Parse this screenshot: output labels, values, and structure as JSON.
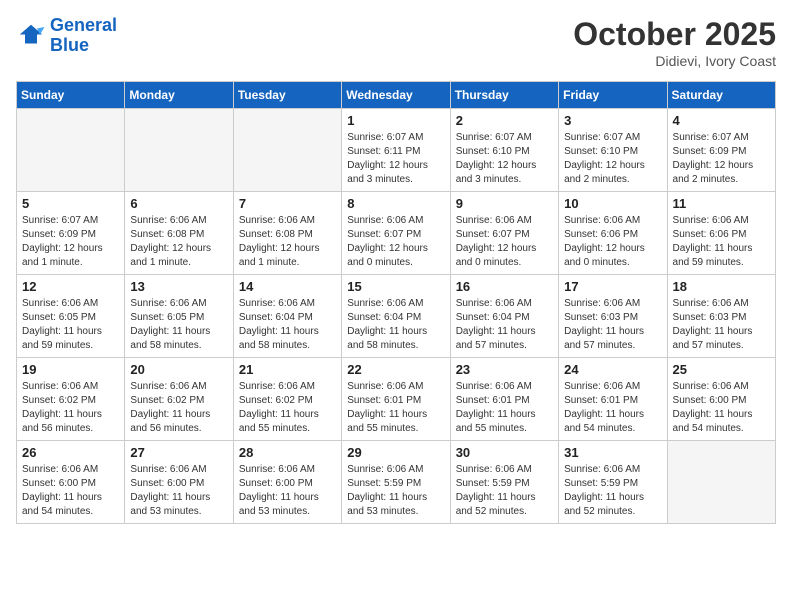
{
  "header": {
    "logo_line1": "General",
    "logo_line2": "Blue",
    "month_year": "October 2025",
    "location": "Didievi, Ivory Coast"
  },
  "days_of_week": [
    "Sunday",
    "Monday",
    "Tuesday",
    "Wednesday",
    "Thursday",
    "Friday",
    "Saturday"
  ],
  "weeks": [
    [
      {
        "day": "",
        "info": ""
      },
      {
        "day": "",
        "info": ""
      },
      {
        "day": "",
        "info": ""
      },
      {
        "day": "1",
        "info": "Sunrise: 6:07 AM\nSunset: 6:11 PM\nDaylight: 12 hours and 3 minutes."
      },
      {
        "day": "2",
        "info": "Sunrise: 6:07 AM\nSunset: 6:10 PM\nDaylight: 12 hours and 3 minutes."
      },
      {
        "day": "3",
        "info": "Sunrise: 6:07 AM\nSunset: 6:10 PM\nDaylight: 12 hours and 2 minutes."
      },
      {
        "day": "4",
        "info": "Sunrise: 6:07 AM\nSunset: 6:09 PM\nDaylight: 12 hours and 2 minutes."
      }
    ],
    [
      {
        "day": "5",
        "info": "Sunrise: 6:07 AM\nSunset: 6:09 PM\nDaylight: 12 hours and 1 minute."
      },
      {
        "day": "6",
        "info": "Sunrise: 6:06 AM\nSunset: 6:08 PM\nDaylight: 12 hours and 1 minute."
      },
      {
        "day": "7",
        "info": "Sunrise: 6:06 AM\nSunset: 6:08 PM\nDaylight: 12 hours and 1 minute."
      },
      {
        "day": "8",
        "info": "Sunrise: 6:06 AM\nSunset: 6:07 PM\nDaylight: 12 hours and 0 minutes."
      },
      {
        "day": "9",
        "info": "Sunrise: 6:06 AM\nSunset: 6:07 PM\nDaylight: 12 hours and 0 minutes."
      },
      {
        "day": "10",
        "info": "Sunrise: 6:06 AM\nSunset: 6:06 PM\nDaylight: 12 hours and 0 minutes."
      },
      {
        "day": "11",
        "info": "Sunrise: 6:06 AM\nSunset: 6:06 PM\nDaylight: 11 hours and 59 minutes."
      }
    ],
    [
      {
        "day": "12",
        "info": "Sunrise: 6:06 AM\nSunset: 6:05 PM\nDaylight: 11 hours and 59 minutes."
      },
      {
        "day": "13",
        "info": "Sunrise: 6:06 AM\nSunset: 6:05 PM\nDaylight: 11 hours and 58 minutes."
      },
      {
        "day": "14",
        "info": "Sunrise: 6:06 AM\nSunset: 6:04 PM\nDaylight: 11 hours and 58 minutes."
      },
      {
        "day": "15",
        "info": "Sunrise: 6:06 AM\nSunset: 6:04 PM\nDaylight: 11 hours and 58 minutes."
      },
      {
        "day": "16",
        "info": "Sunrise: 6:06 AM\nSunset: 6:04 PM\nDaylight: 11 hours and 57 minutes."
      },
      {
        "day": "17",
        "info": "Sunrise: 6:06 AM\nSunset: 6:03 PM\nDaylight: 11 hours and 57 minutes."
      },
      {
        "day": "18",
        "info": "Sunrise: 6:06 AM\nSunset: 6:03 PM\nDaylight: 11 hours and 57 minutes."
      }
    ],
    [
      {
        "day": "19",
        "info": "Sunrise: 6:06 AM\nSunset: 6:02 PM\nDaylight: 11 hours and 56 minutes."
      },
      {
        "day": "20",
        "info": "Sunrise: 6:06 AM\nSunset: 6:02 PM\nDaylight: 11 hours and 56 minutes."
      },
      {
        "day": "21",
        "info": "Sunrise: 6:06 AM\nSunset: 6:02 PM\nDaylight: 11 hours and 55 minutes."
      },
      {
        "day": "22",
        "info": "Sunrise: 6:06 AM\nSunset: 6:01 PM\nDaylight: 11 hours and 55 minutes."
      },
      {
        "day": "23",
        "info": "Sunrise: 6:06 AM\nSunset: 6:01 PM\nDaylight: 11 hours and 55 minutes."
      },
      {
        "day": "24",
        "info": "Sunrise: 6:06 AM\nSunset: 6:01 PM\nDaylight: 11 hours and 54 minutes."
      },
      {
        "day": "25",
        "info": "Sunrise: 6:06 AM\nSunset: 6:00 PM\nDaylight: 11 hours and 54 minutes."
      }
    ],
    [
      {
        "day": "26",
        "info": "Sunrise: 6:06 AM\nSunset: 6:00 PM\nDaylight: 11 hours and 54 minutes."
      },
      {
        "day": "27",
        "info": "Sunrise: 6:06 AM\nSunset: 6:00 PM\nDaylight: 11 hours and 53 minutes."
      },
      {
        "day": "28",
        "info": "Sunrise: 6:06 AM\nSunset: 6:00 PM\nDaylight: 11 hours and 53 minutes."
      },
      {
        "day": "29",
        "info": "Sunrise: 6:06 AM\nSunset: 5:59 PM\nDaylight: 11 hours and 53 minutes."
      },
      {
        "day": "30",
        "info": "Sunrise: 6:06 AM\nSunset: 5:59 PM\nDaylight: 11 hours and 52 minutes."
      },
      {
        "day": "31",
        "info": "Sunrise: 6:06 AM\nSunset: 5:59 PM\nDaylight: 11 hours and 52 minutes."
      },
      {
        "day": "",
        "info": ""
      }
    ]
  ]
}
